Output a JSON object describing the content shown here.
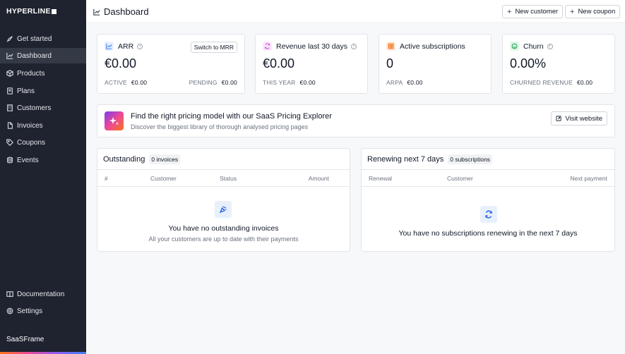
{
  "brand": {
    "name": "HYPERLINE"
  },
  "sidebar": {
    "items": [
      {
        "label": "Get started",
        "icon": "rocket-icon"
      },
      {
        "label": "Dashboard",
        "icon": "chart-line-icon",
        "active": true
      },
      {
        "label": "Products",
        "icon": "box-icon"
      },
      {
        "label": "Plans",
        "icon": "layers-icon"
      },
      {
        "label": "Customers",
        "icon": "building-icon"
      },
      {
        "label": "Invoices",
        "icon": "file-icon"
      },
      {
        "label": "Coupons",
        "icon": "tag-icon"
      },
      {
        "label": "Events",
        "icon": "database-icon"
      }
    ],
    "bottom_items": [
      {
        "label": "Documentation",
        "icon": "book-icon"
      },
      {
        "label": "Settings",
        "icon": "gear-icon"
      }
    ],
    "workspace": "SaaSFrame"
  },
  "header": {
    "title": "Dashboard",
    "new_customer_label": "New customer",
    "new_coupon_label": "New coupon"
  },
  "stats": {
    "arr": {
      "title": "ARR",
      "value": "€0.00",
      "switch_label": "Switch to MRR",
      "sub1_label": "ACTIVE",
      "sub1_value": "€0.00",
      "sub2_label": "PENDING",
      "sub2_value": "€0.00"
    },
    "revenue": {
      "title": "Revenue last 30 days",
      "value": "€0.00",
      "sub1_label": "THIS YEAR",
      "sub1_value": "€0.00"
    },
    "subscriptions": {
      "title": "Active subscriptions",
      "value": "0",
      "sub1_label": "ARPA",
      "sub1_value": "€0.00"
    },
    "churn": {
      "title": "Churn",
      "value": "0.00%",
      "sub1_label": "CHURNED REVENUE",
      "sub1_value": "€0.00"
    }
  },
  "banner": {
    "title": "Find the right pricing model with our SaaS Pricing Explorer",
    "subtitle": "Discover the biggest library of thorough analysed pricing pages",
    "button_label": "Visit website"
  },
  "outstanding": {
    "title": "Outstanding",
    "badge": "0 invoices",
    "columns": [
      "#",
      "Customer",
      "Status",
      "Amount"
    ],
    "empty_title": "You have no outstanding invoices",
    "empty_subtitle": "All your customers are up to date with their payments"
  },
  "renewing": {
    "title": "Renewing next 7 days",
    "badge": "0 subscriptions",
    "columns": [
      "Renewal",
      "Customer",
      "Next payment"
    ],
    "empty_title": "You have no subscriptions renewing in the next 7 days"
  },
  "colors": {
    "sidebar_bg": "#1f2330",
    "accent_blue": "#2563eb",
    "arr_icon": "#3b82f6",
    "revenue_icon": "#d946ef",
    "subscriptions_icon": "#f97316",
    "churn_icon": "#16a34a"
  }
}
